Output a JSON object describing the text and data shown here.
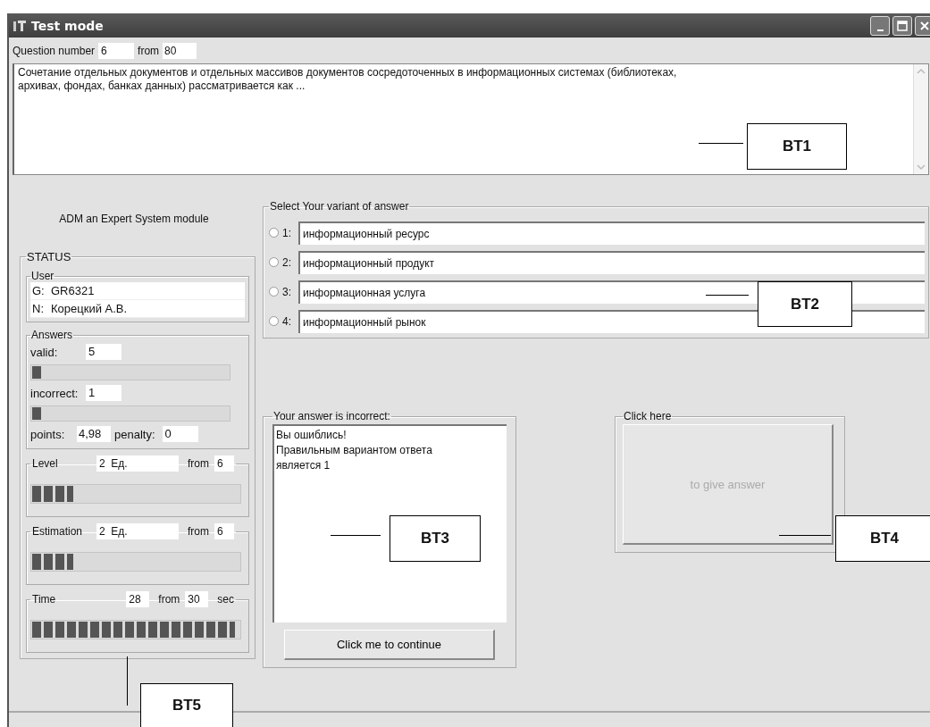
{
  "window": {
    "title": "Test mode"
  },
  "question": {
    "label": "Question number",
    "number": "6",
    "from_label": "from",
    "total": "80",
    "text": "Сочетание отдельных документов и отдельных массивов документов сосредоточенных в информационных системах (библиотеках, архивах, фондах, банках данных) рассматривается как ..."
  },
  "module_title": "ADM an Expert System module",
  "status": {
    "title": "STATUS",
    "user": {
      "title": "User",
      "group_label": "G:",
      "group": "GR6321",
      "name_label": "N:",
      "name": "Корецкий А.В."
    },
    "answers": {
      "title": "Answers",
      "valid": {
        "label": "valid:",
        "value": "5",
        "level": 0.05
      },
      "incorrect": {
        "label": "incorrect:",
        "value": "1",
        "level": 0.05
      },
      "points_label": "points:",
      "points": "4,98",
      "penalty_label": "penalty:",
      "penalty": "0"
    },
    "meters": [
      {
        "title": "Level",
        "value": "2",
        "unit": "Ед.",
        "from_label": "from",
        "total": "6",
        "level": 0.2
      },
      {
        "title": "Estimation",
        "value": "2",
        "unit": "Ед.",
        "from_label": "from",
        "total": "6",
        "level": 0.2
      },
      {
        "title": "Time",
        "value": "28",
        "from_label": "from",
        "total": "30",
        "unit": "sec",
        "kind": "time",
        "level": 0.98
      }
    ]
  },
  "variants": {
    "title": "Select Your variant of answer",
    "options": [
      {
        "number": "1:",
        "text": "информационный ресурс",
        "selected": false
      },
      {
        "number": "2:",
        "text": "информационный продукт",
        "selected": false
      },
      {
        "number": "3:",
        "text": "информационная услуга",
        "selected": false
      },
      {
        "number": "4:",
        "text": "информационный рынок",
        "selected": false
      }
    ]
  },
  "feedback": {
    "title": "Your answer is incorrect:",
    "lines": [
      "Вы ошиблись!",
      "Правильным вариантом ответа",
      "является 1"
    ],
    "button": "Click me to continue"
  },
  "submit": {
    "title": "Click here",
    "button": "to give answer",
    "disabled": true
  },
  "annotations": [
    {
      "label": "BT1"
    },
    {
      "label": "BT2"
    },
    {
      "label": "BT3"
    },
    {
      "label": "BT4"
    },
    {
      "label": "BT5"
    }
  ]
}
